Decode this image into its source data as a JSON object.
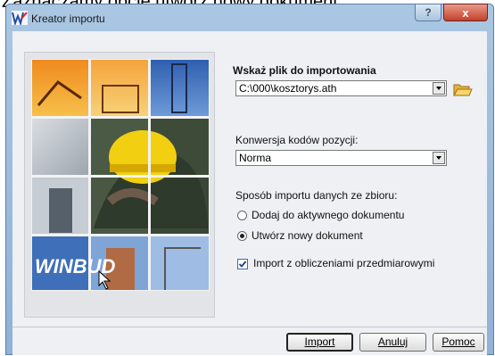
{
  "caption": "Zaznaczamy opcję utwórz nowy dokument",
  "window": {
    "title": "Kreator importu",
    "help_label": "?",
    "close_label": "x"
  },
  "logo_text": "WINBUD",
  "file_section": {
    "label": "Wskaż plik do importowania",
    "path_value": "C:\\000\\kosztorys.ath"
  },
  "conversion": {
    "label": "Konwersja kodów pozycji:",
    "selected": "Norma"
  },
  "mode": {
    "label": "Sposób importu danych ze zbioru:",
    "options": [
      {
        "label": "Dodaj do aktywnego dokumentu",
        "selected": false
      },
      {
        "label": "Utwórz nowy dokument",
        "selected": true
      }
    ]
  },
  "calculations": {
    "label": "Import z obliczeniami przedmiarowymi",
    "checked": true
  },
  "buttons": {
    "import": "Import",
    "cancel": "Anuluj",
    "help": "Pomoc"
  },
  "colors": {
    "title_bar": "#9dbbdb",
    "close_button": "#c3412b",
    "dialog_bg": "#eef0f3",
    "logo_blue": "#3e6fb8"
  }
}
